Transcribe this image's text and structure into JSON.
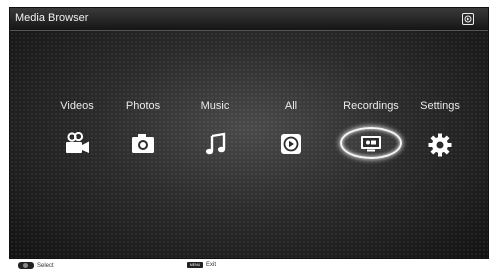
{
  "header": {
    "title": "Media Browser",
    "corner_icon": "source-icon"
  },
  "menu": {
    "items": [
      {
        "label": "Videos",
        "icon": "video-camera-icon"
      },
      {
        "label": "Photos",
        "icon": "camera-icon"
      },
      {
        "label": "Music",
        "icon": "music-note-icon"
      },
      {
        "label": "All",
        "icon": "play-all-icon"
      },
      {
        "label": "Recordings",
        "icon": "recordings-icon",
        "selected": true
      },
      {
        "label": "Settings",
        "icon": "gear-icon"
      }
    ]
  },
  "footer": {
    "select_label": "Select",
    "menu_key": "MENU",
    "exit_label": "Exit"
  }
}
